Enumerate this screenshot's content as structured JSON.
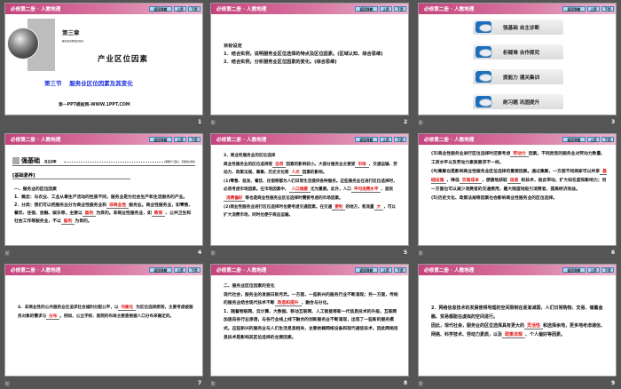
{
  "header_title": "必修第二册 · 人教地理",
  "nav": {
    "back": "返回导航",
    "prev": "上页",
    "next": "下页"
  },
  "animation_glyph": "阶",
  "slides": [
    {
      "number": "1",
      "chapter": "第三章",
      "chapter_sub": "服务业区位因素及其变化",
      "title": "产业区位因素",
      "section": "第三节　 服务业区位因素及其变化",
      "footer": "第一PPT模板网-WWW.1PPT.COM"
    },
    {
      "number": "2",
      "paragraphs": [
        [
          {
            "t": "目标设定"
          }
        ],
        [
          {
            "t": "1．结合实例，说明服务业区位选择的特点及区位因素。(区域认知、综合思维)"
          }
        ],
        [
          {
            "t": "2．结合实例，分析服务业区位因素的变化。(综合思维)"
          }
        ]
      ]
    },
    {
      "number": "3",
      "buttons": [
        "强基础 自主诊断",
        "析疑难 合作探究",
        "提能力 通关集训",
        "刷习题 巩固提升"
      ]
    },
    {
      "number": "4",
      "banner": "强基础",
      "banner_sub": "自主诊断",
      "banner_right": "明确学习目标，掌握知识体系",
      "box_label": "[基础素养]",
      "paragraphs": [
        [
          {
            "t": "一、服务业的区位因素"
          }
        ],
        [
          {
            "t": "1．概念：与农业、工业从事生产活动的性质不同，服务业是为社会生产和生活服务的产业。"
          }
        ],
        [
          {
            "t": "2．分类：我们可以把服务业分为商业性服务业和"
          },
          {
            "b": "非商业性"
          },
          {
            "t": "服务业。商业性服务业，如零售、餐饮、住宿、金融、娱乐等，主要以"
          },
          {
            "b": "盈利"
          },
          {
            "t": "为目的。非商业性服务业，如"
          },
          {
            "b": "教育"
          },
          {
            "t": "、公共卫生和社会工作等服务业，不以"
          },
          {
            "b": "盈利"
          },
          {
            "t": "为目的。"
          }
        ]
      ]
    },
    {
      "number": "5",
      "paragraphs": [
        [
          {
            "t": "3．商业性服务业的区位选择"
          }
        ],
        [
          {
            "t": "商业性服务业的区位选择受"
          },
          {
            "b": "自然"
          },
          {
            "t": "因素的影响较小。大部分服务业主要受"
          },
          {
            "b": "市场"
          },
          {
            "t": "、交通运输、劳动力、政策法规、集聚、历史文化等"
          },
          {
            "b": "人文"
          },
          {
            "t": "因素的影响。"
          }
        ],
        [
          {
            "t": "(1)零售、批发、餐饮、住宿等都为人们日常生活提供各种服务。这些服务业在进行区位选择时，必须考虑市场因素。在市场因素中，"
          },
          {
            "b": "人口规模"
          },
          {
            "t": "尤为重要。此外，人口"
          },
          {
            "b": "平均消费水平"
          },
          {
            "t": "、居民"
          },
          {
            "b": "消费偏好"
          },
          {
            "t": "等也是商业性服务业区位选择时需要考虑的市场因素。"
          }
        ],
        [
          {
            "t": "(2)商业性服务业进行区位选择时也要考虑交通因素。在交通"
          },
          {
            "b": "便利"
          },
          {
            "t": "的地方，客流量"
          },
          {
            "b": "大"
          },
          {
            "t": "，可以扩大消费市场，同时也便于商品运输。"
          }
        ]
      ]
    },
    {
      "number": "6",
      "paragraphs": [
        [
          {
            "t": "(3)商业性服务业进行区位选择时还要考虑"
          },
          {
            "b": "劳动力"
          },
          {
            "t": "因素。不同类型的服务业对劳动力数量、工资水平以及劳动力素质要求不一样。"
          }
        ],
        [
          {
            "t": "(4)集聚也是影响商业性服务业区位选择的重要因素。通过集聚，一方面不同商家可以共享"
          },
          {
            "b": "基础设施"
          },
          {
            "t": "，降低"
          },
          {
            "b": "交易成本"
          },
          {
            "t": "，便捷地获取"
          },
          {
            "b": "信息"
          },
          {
            "t": "和技术，彼此带动，扩大知名度和影响力；另一方面也可以减少消费者的交通费用，最大限度地吸引消费者，提高经济效益。"
          }
        ],
        [
          {
            "t": "(5)历史文化、政策法规等因素也会影响商业性服务业的区位选择。"
          }
        ]
      ]
    },
    {
      "number": "7",
      "paragraphs": [
        [
          {
            "t": "4．非商业性的公共服务业在追求社会福利分配公平，以"
          },
          {
            "b": "均衡化"
          },
          {
            "t": "为区位选择原则，主要考虑被服务对象的需求与"
          },
          {
            "b": "分布"
          },
          {
            "t": "。例如，公立学校、医院的布局主要是根据人口分布来确定的。"
          }
        ]
      ]
    },
    {
      "number": "8",
      "paragraphs": [
        [
          {
            "t": "二、服务业区位因素的变化"
          }
        ],
        [
          {
            "t": "现代社会，服务业的发展日新月异。一方面，一些新兴的服务行业不断涌现；另一方面，传统的服务业结合现代技术不断"
          },
          {
            "b": "改造和提升"
          },
          {
            "t": "，融合与分化。"
          }
        ],
        [
          {
            "t": "1．随着物联网、云计算、大数据、移动互联网、人工智能等新一代信息技术的升级，互联网加速向各行业渗透，与各行业线上线下融合的创新服务业不断涌现，出现了一些新的服务模式。这些新兴的服务业与人们生活息息相关，主要依赖网络设备和现代通信技术，因此网络信息技术是影响其区位选择的主要因素。"
          }
        ]
      ]
    },
    {
      "number": "9",
      "paragraphs": [
        [
          {
            "t": "2．网络信息技术的发展使得地理的空间限制在逐渐减弱，人们日常购物、交易、储蓄金融、贸易都能在虚拟的空间进行。"
          }
        ],
        [
          {
            "t": "因此，现代社会，服务业的区位选择具有更大的"
          },
          {
            "b": "灵活性"
          },
          {
            "t": "和选择余地，更多地考虑通信、网络、科学技术、劳动力素质，以及"
          },
          {
            "b": "政策法规"
          },
          {
            "t": "、个人偏好等因素。"
          }
        ]
      ]
    }
  ]
}
